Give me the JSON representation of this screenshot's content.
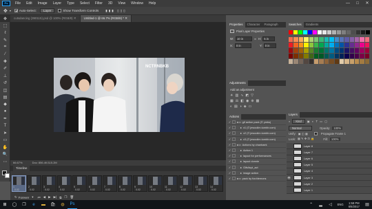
{
  "app": {
    "logo": "Ps",
    "menu": [
      "File",
      "Edit",
      "Image",
      "Layer",
      "Type",
      "Select",
      "Filter",
      "3D",
      "View",
      "Window",
      "Help"
    ],
    "window_controls": [
      "—",
      "□",
      "✕"
    ]
  },
  "options_bar": {
    "auto_select_label": "Auto-Select:",
    "auto_select_value": "Layer",
    "show_transform_label": "Show Transform Controls"
  },
  "doc_tabs": [
    {
      "label": "cutsdancing (390115).psd @ 100% (RGB/8)",
      "close": "✕",
      "active": false
    },
    {
      "label": "Untitled-1 @ 66.7% (RGB/8) *",
      "close": "✕",
      "active": true
    }
  ],
  "canvas": {
    "watermark": "NCTRNBKB"
  },
  "status": {
    "zoom": "66.67%",
    "doc": "Doc: 856.4K/115.2M"
  },
  "timeline": {
    "title": "Timeline",
    "frames": [
      {
        "n": "1",
        "d": "0.02"
      },
      {
        "n": "2",
        "d": "0.02"
      },
      {
        "n": "3",
        "d": "0.02"
      },
      {
        "n": "4",
        "d": "0.02"
      },
      {
        "n": "5",
        "d": "0.02"
      },
      {
        "n": "6",
        "d": "0.02"
      },
      {
        "n": "7",
        "d": "0.02"
      },
      {
        "n": "8",
        "d": "0.02"
      },
      {
        "n": "9",
        "d": "0.02"
      },
      {
        "n": "10",
        "d": "0.02"
      },
      {
        "n": "11",
        "d": "0.02"
      },
      {
        "n": "12",
        "d": "0.02"
      },
      {
        "n": "13",
        "d": "0.02"
      },
      {
        "n": "14",
        "d": "0.02"
      }
    ],
    "loop": "Forever"
  },
  "properties": {
    "tabs": [
      "Properties",
      "Character",
      "Paragraph"
    ],
    "title": "Pixel Layer Properties",
    "w_label": "W:",
    "w_value": "10 in",
    "h_label": "H:",
    "h_value": "5 in",
    "x_label": "X:",
    "x_value": "0 in",
    "y_label": "Y:",
    "y_value": "0 in",
    "go_label": "GO"
  },
  "adjustments": {
    "tab": "Adjustments",
    "add_label": "Add an adjustment"
  },
  "actions": {
    "tab": "Actions",
    "items": [
      {
        "label": "gif action pack (© ymks)",
        "indent": 0,
        "folder": true
      },
      {
        "label": "v1 (© jewoolim.tumblr.com)",
        "indent": 1,
        "folder": false
      },
      {
        "label": "v2 (© jewoolim.tumblr.com)",
        "indent": 1,
        "folder": false
      },
      {
        "label": "v3 (© jewoolim.tumblr.com)",
        "indent": 1,
        "folder": false
      },
      {
        "label": "Actions by chanbaek",
        "indent": 0,
        "folder": true
      },
      {
        "label": "Action 1",
        "indent": 1,
        "folder": false
      },
      {
        "label": "layout for performances",
        "indent": 1,
        "folder": false
      },
      {
        "label": "layout donnie",
        "indent": 1,
        "folder": false
      },
      {
        "label": "Gifs/tupi_act",
        "indent": 1,
        "folder": false
      },
      {
        "label": "image action",
        "indent": 1,
        "folder": false
      },
      {
        "label": "pack by fun/demons",
        "indent": 0,
        "folder": true
      }
    ]
  },
  "swatches": {
    "tabs": [
      "Swatches",
      "Gradients"
    ],
    "row_colors": [
      "#ff0000",
      "#ffff00",
      "#00ff00",
      "#00ffff",
      "#0000ff",
      "#ff00ff",
      "#ffffff",
      "#e6e6e6",
      "#cccccc",
      "#b3b3b3",
      "#999999",
      "#808080",
      "#666666",
      "#4d4d4d",
      "#333333",
      "#1a1a1a",
      "#000000"
    ],
    "grid_colors": [
      [
        "#f26c4f",
        "#f68e55",
        "#fbaf5c",
        "#fff467",
        "#acd372",
        "#7cc576",
        "#3bb878",
        "#1abbb4",
        "#00bff3",
        "#438ccb",
        "#5574b9",
        "#605ca8",
        "#855fa8",
        "#a763a8",
        "#f06ea9",
        "#f26d7d"
      ],
      [
        "#ed1c24",
        "#f26522",
        "#f7941d",
        "#fff200",
        "#8dc73f",
        "#39b54a",
        "#00a651",
        "#00a99d",
        "#00aeef",
        "#0072bc",
        "#0054a6",
        "#2e3192",
        "#662d91",
        "#92278f",
        "#ec008c",
        "#ed145b"
      ],
      [
        "#9e0b0f",
        "#a0410d",
        "#a3620a",
        "#aba000",
        "#598527",
        "#1a7b30",
        "#007236",
        "#00746b",
        "#0076a3",
        "#004b80",
        "#003471",
        "#1b1464",
        "#440e62",
        "#630460",
        "#9e005d",
        "#9e0039"
      ],
      [
        "#790000",
        "#7b2e00",
        "#7d4900",
        "#827b00",
        "#406618",
        "#005e20",
        "#005826",
        "#005952",
        "#005b7f",
        "#003663",
        "#002157",
        "#0d004c",
        "#32004b",
        "#4b0049",
        "#7b0046",
        "#7a0026"
      ],
      [
        "#c7b299",
        "#998675",
        "#736357",
        "#534741",
        "#37302d",
        "#c69c6d",
        "#a67c52",
        "#8c6239",
        "#754c24",
        "#603913",
        "#e2ccaa",
        "#d6b68a",
        "#c8a06a",
        "#b98c4e",
        "#a37b41",
        "#8b6a37"
      ]
    ]
  },
  "layers": {
    "tabs": [
      "Layers"
    ],
    "kind_label": "Kind",
    "blend_value": "Normal",
    "opacity_label": "Opacity:",
    "opacity_value": "100%",
    "unify_label": "Unify:",
    "propagate_label": "Propagate Frame 1",
    "lock_label": "Lock:",
    "fill_label": "Fill:",
    "fill_value": "100%",
    "items": [
      {
        "label": "Layer 8",
        "visible": false
      },
      {
        "label": "Layer 7",
        "visible": false
      },
      {
        "label": "Layer 6",
        "visible": false
      },
      {
        "label": "Layer 5",
        "visible": false
      },
      {
        "label": "Layer 4",
        "visible": false
      },
      {
        "label": "Layer 3",
        "visible": true
      },
      {
        "label": "Layer 2",
        "visible": false
      },
      {
        "label": "Layer 1",
        "visible": false
      }
    ]
  },
  "taskbar": {
    "time": "1:58 PM",
    "date": "6/6/2017",
    "lang": "ENG"
  },
  "colors": {
    "accent": "#31a8ff",
    "panel": "#535353",
    "panel_dark": "#323232",
    "canvas_bg": "#282828"
  }
}
